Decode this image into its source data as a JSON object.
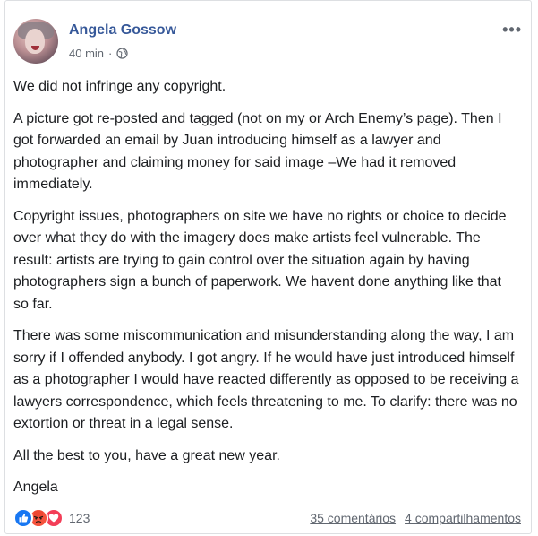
{
  "post": {
    "author": "Angela Gossow",
    "time": "40 min",
    "separator": "·",
    "privacy_icon": "globe-icon",
    "more_icon": "more-dots-icon",
    "paragraphs": [
      "We did not infringe any copyright.",
      "A picture got re-posted and tagged (not on my or Arch Enemy’s page). Then I got forwarded an email by Juan introducing himself as a lawyer and photographer and claiming money for said image –We had it removed immediately.",
      "Copyright issues, photographers on site we have no rights or choice to decide over what they do with the imagery does make artists feel vulnerable. The result: artists are trying to gain control over the situation again by having photographers sign a bunch of paperwork. We havent done anything like that so far.",
      "There was some miscommunication and misunderstanding along the way, I am sorry if I offended anybody. I got angry. If he would have just introduced himself as a photographer I would have reacted differently as opposed to be receiving a lawyers correspondence, which feels threatening to me. To clarify: there was no extortion or threat in a legal sense.",
      "All the best to you, have a great new year.",
      "Angela"
    ]
  },
  "footer": {
    "reactions": [
      "like-icon",
      "angry-icon",
      "love-icon"
    ],
    "reaction_count": "123",
    "comments": "35 comentários",
    "shares": "4 compartilhamentos"
  },
  "colors": {
    "author": "#365899",
    "meta": "#616770",
    "text": "#1c1e21",
    "like": "#1877f2",
    "angry": "#f5533d",
    "love": "#f33e58"
  }
}
